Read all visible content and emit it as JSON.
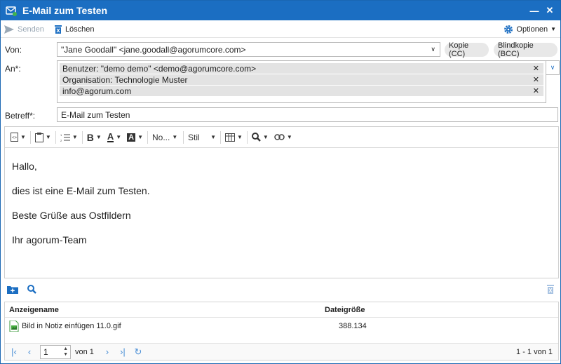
{
  "window": {
    "title": "E-Mail zum Testen"
  },
  "toolbar": {
    "send_label": "Senden",
    "delete_label": "Löschen",
    "options_label": "Optionen"
  },
  "form": {
    "from_label": "Von:",
    "from_value": "\"Jane Goodall\" <jane.goodall@agorumcore.com>",
    "cc_label": "Kopie (CC)",
    "bcc_label": "Blindkopie (BCC)",
    "to_label": "An*:",
    "recipients": [
      "Benutzer: \"demo demo\" <demo@agorumcore.com>",
      "Organisation: Technologie Muster",
      "info@agorum.com"
    ],
    "subject_label": "Betreff*:",
    "subject_value": "E-Mail zum Testen"
  },
  "editor": {
    "font_name": "No...",
    "style_name": "Stil",
    "body_lines": [
      "Hallo,",
      "dies ist eine E-Mail zum Testen.",
      "Beste Grüße aus Ostfildern",
      "Ihr agorum-Team"
    ]
  },
  "attachments": {
    "col_name": "Anzeigename",
    "col_size": "Dateigröße",
    "rows": [
      {
        "name": "Bild in Notiz einfügen 11.0.gif",
        "size": "388.134"
      }
    ]
  },
  "pager": {
    "page": "1",
    "of_label": "von 1",
    "summary": "1 - 1 von 1"
  },
  "colors": {
    "titlebar": "#1b6ec2",
    "accent": "#1b6ec2"
  }
}
